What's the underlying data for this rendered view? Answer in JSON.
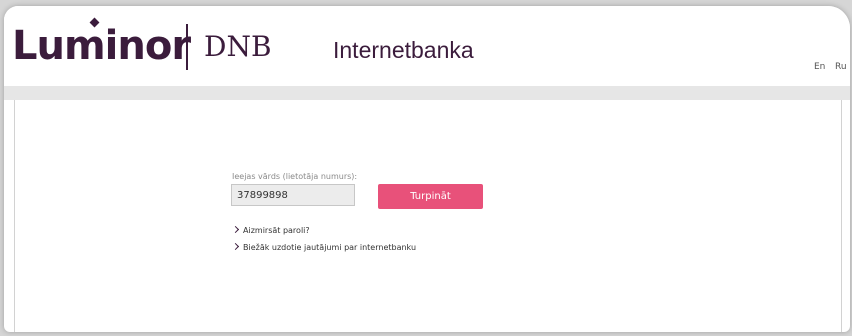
{
  "header": {
    "brand_primary": "Luminor",
    "brand_secondary": "DNB",
    "app_title": "Internetbanka",
    "languages": [
      "En",
      "Ru"
    ]
  },
  "login": {
    "username_label": "Ieejas vārds (lietotāja numurs):",
    "username_value": "37899898",
    "continue_label": "Turpināt"
  },
  "links": {
    "forgot_password": "Aizmirsāt paroli?",
    "faq": "Biežāk uzdotie jautājumi par internetbanku"
  },
  "colors": {
    "brand": "#3b1c3c",
    "accent": "#e8517a",
    "background": "#d6d6d6"
  },
  "icons": [
    "chevron-right-icon"
  ]
}
